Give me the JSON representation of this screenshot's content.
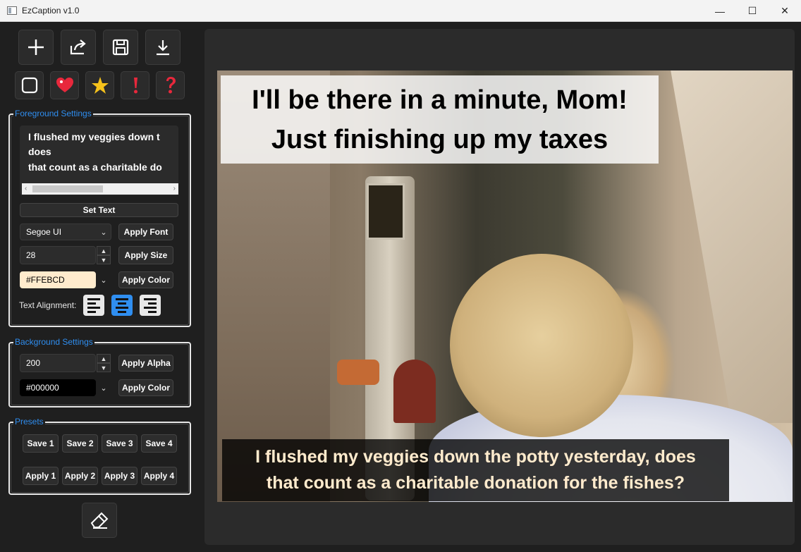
{
  "window": {
    "title": "EzCaption v1.0",
    "minimize_glyph": "—",
    "maximize_glyph": "☐",
    "close_glyph": "✕"
  },
  "toolbar": {
    "icons": [
      "plus-icon",
      "share-icon",
      "save-icon",
      "download-icon"
    ]
  },
  "presets_quick": {
    "icons": [
      "square-icon",
      "heart-icon",
      "star-icon",
      "exclamation-icon",
      "question-icon"
    ]
  },
  "foreground": {
    "title": "Foreground Settings",
    "text_lines": [
      "I flushed my veggies down t",
      "does",
      "that count as a charitable do"
    ],
    "set_text_label": "Set Text",
    "font_value": "Segoe UI",
    "apply_font_label": "Apply Font",
    "size_value": "28",
    "apply_size_label": "Apply Size",
    "color_value": "#FFEBCD",
    "apply_color_label": "Apply Color",
    "alignment_label": "Text Alignment:",
    "alignment_selected": "center"
  },
  "background": {
    "title": "Background Settings",
    "alpha_value": "200",
    "apply_alpha_label": "Apply Alpha",
    "color_value": "#000000",
    "apply_color_label": "Apply Color"
  },
  "presets": {
    "title": "Presets",
    "save_labels": [
      "Save 1",
      "Save 2",
      "Save 3",
      "Save 4"
    ],
    "apply_labels": [
      "Apply 1",
      "Apply 2",
      "Apply 3",
      "Apply 4"
    ]
  },
  "eraser": {
    "icon": "eraser-icon"
  },
  "caption_top": {
    "lines": [
      "I'll be there in a minute, Mom!",
      "Just finishing up my taxes"
    ]
  },
  "caption_bottom": {
    "lines": [
      "I flushed my veggies down the potty yesterday, does",
      "that count as a charitable donation for the fishes?"
    ]
  },
  "colors": {
    "accent": "#2f8ef0",
    "foreground_text": "#FFEBCD",
    "background_fill": "#000000"
  }
}
